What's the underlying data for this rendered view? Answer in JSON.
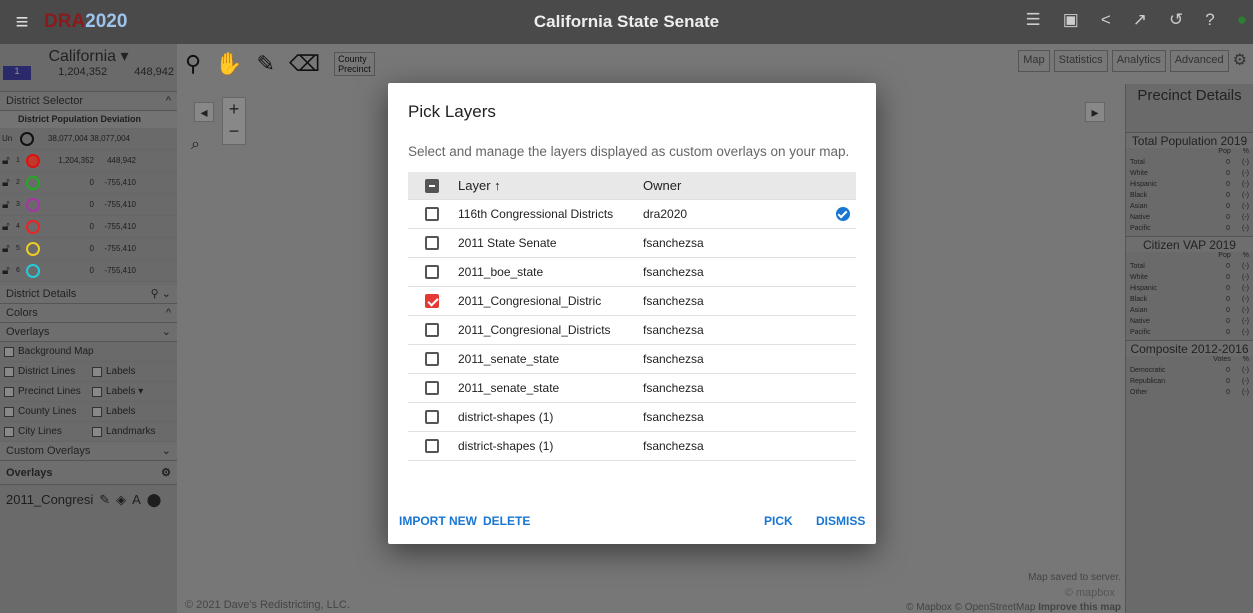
{
  "topbar": {
    "menu_glyph": "≡",
    "logo_a": "DRA",
    "logo_b": "2020",
    "title": "California State Senate"
  },
  "state": {
    "name": "California ▾",
    "swatch": "1",
    "pop": "1,204,352",
    "dev": "448,942"
  },
  "left": {
    "district_selector": "District Selector",
    "table_header": "District Population  Deviation",
    "unassigned": {
      "label": "Un",
      "pop": "38,077,004",
      "dev": "38,077,004"
    },
    "districts": [
      {
        "num": "1",
        "color": "#d11",
        "fill": "#c0392b",
        "pop": "1,204,352",
        "dev": "448,942"
      },
      {
        "num": "2",
        "color": "#2a2",
        "fill": "none",
        "pop": "0",
        "dev": "-755,410"
      },
      {
        "num": "3",
        "color": "#a3a",
        "fill": "none",
        "pop": "0",
        "dev": "-755,410"
      },
      {
        "num": "4",
        "color": "#e22",
        "fill": "none",
        "pop": "0",
        "dev": "-755,410"
      },
      {
        "num": "5",
        "color": "#ec2",
        "fill": "none",
        "pop": "0",
        "dev": "-755,410"
      },
      {
        "num": "6",
        "color": "#2cd",
        "fill": "none",
        "pop": "0",
        "dev": "-755,410"
      }
    ],
    "district_details": "District Details",
    "colors": "Colors",
    "overlays": "Overlays",
    "background_map": "Background Map",
    "district_lines": "District Lines",
    "labels": "Labels",
    "precinct_lines": "Precinct Lines",
    "labels_dd": "Labels ▾",
    "county_lines": "County Lines",
    "city_lines": "City Lines",
    "landmarks": "Landmarks",
    "custom_overlays": "Custom Overlays",
    "overlays_sub": "Overlays",
    "overlay_item": "2011_Congresi"
  },
  "toolbar": {
    "county": "County",
    "precinct": "Precinct",
    "tools": "Tools ▾"
  },
  "rightbtns": {
    "map": "Map",
    "statistics": "Statistics",
    "analytics": "Analytics",
    "advanced": "Advanced"
  },
  "precinct": {
    "title": "Precinct Details",
    "total_pop": "Total Population 2019",
    "cvap": "Citizen VAP 2019",
    "composite": "Composite 2012-2016",
    "pop": "Pop",
    "votes": "Votes",
    "pct": "%",
    "rows1": [
      "Total",
      "White",
      "Hispanic",
      "Black",
      "Asian",
      "Native",
      "Pacific"
    ],
    "rows3": [
      "Democratic",
      "Republican",
      "Other"
    ],
    "zero": "0",
    "dash": "(-)"
  },
  "map": {
    "copyright": "© 2021 Dave's Redistricting, LLC.",
    "saved": "Map saved to server.",
    "mapbox": "© mapbox",
    "attrib": "© Mapbox © OpenStreetMap",
    "improve": "Improve this map"
  },
  "modal": {
    "title": "Pick Layers",
    "description": "Select and manage the layers displayed as custom overlays on your map.",
    "col_layer": "Layer ↑",
    "col_owner": "Owner",
    "rows": [
      {
        "layer": "116th Congressional Districts",
        "owner": "dra2020",
        "checked": false,
        "verified": true
      },
      {
        "layer": "2011 State Senate",
        "owner": "fsanchezsa",
        "checked": false,
        "verified": false
      },
      {
        "layer": "2011_boe_state",
        "owner": "fsanchezsa",
        "checked": false,
        "verified": false
      },
      {
        "layer": "2011_Congresional_Distric",
        "owner": "fsanchezsa",
        "checked": true,
        "verified": false
      },
      {
        "layer": "2011_Congresional_Districts",
        "owner": "fsanchezsa",
        "checked": false,
        "verified": false
      },
      {
        "layer": "2011_senate_state",
        "owner": "fsanchezsa",
        "checked": false,
        "verified": false
      },
      {
        "layer": "2011_senate_state",
        "owner": "fsanchezsa",
        "checked": false,
        "verified": false
      },
      {
        "layer": "district-shapes (1)",
        "owner": "fsanchezsa",
        "checked": false,
        "verified": false
      },
      {
        "layer": "district-shapes (1)",
        "owner": "fsanchezsa",
        "checked": false,
        "verified": false
      }
    ],
    "import_new": "IMPORT NEW",
    "delete": "DELETE",
    "pick": "PICK",
    "dismiss": "DISMISS"
  },
  "colors": {
    "accent": "#1976d2",
    "checked": "#e53935",
    "brand": "#8b1a1a"
  }
}
